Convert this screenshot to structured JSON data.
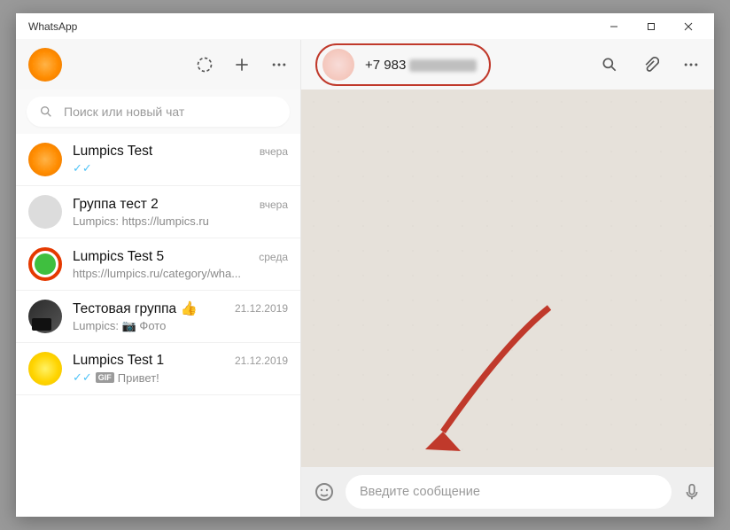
{
  "window": {
    "title": "WhatsApp"
  },
  "sidebar": {
    "search_placeholder": "Поиск или новый чат"
  },
  "chats": [
    {
      "name": "Lumpics Test",
      "time": "вчера",
      "preview_text": "",
      "preview_checks": true
    },
    {
      "name": "Группа тест 2",
      "time": "вчера",
      "preview_text": "Lumpics: https://lumpics.ru"
    },
    {
      "name": "Lumpics Test 5",
      "time": "среда",
      "preview_text": "https://lumpics.ru/category/wha..."
    },
    {
      "name": "Тестовая группа 👍",
      "time": "21.12.2019",
      "preview_text": "Lumpics: 📷 Фото"
    },
    {
      "name": "Lumpics Test 1",
      "time": "21.12.2019",
      "preview_gif": "Привет!",
      "preview_checks": true
    }
  ],
  "conversation": {
    "contact_number": "+7 983",
    "composer_placeholder": "Введите сообщение"
  }
}
